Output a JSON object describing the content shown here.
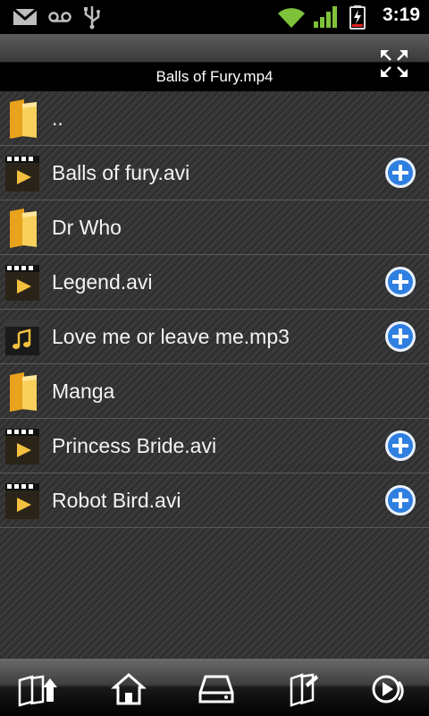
{
  "status_bar": {
    "time": "3:19",
    "icons": [
      "gmail-icon",
      "voicemail-icon",
      "usb-icon",
      "wifi-icon",
      "signal-icon",
      "battery-charging-icon"
    ]
  },
  "header": {
    "title": "Balls of Fury.mp4",
    "fullscreen_icon": "fullscreen-icon"
  },
  "files": [
    {
      "name": "..",
      "type": "folder",
      "addable": false
    },
    {
      "name": "Balls of fury.avi",
      "type": "video",
      "addable": true
    },
    {
      "name": "Dr Who",
      "type": "folder",
      "addable": false
    },
    {
      "name": "Legend.avi",
      "type": "video",
      "addable": true
    },
    {
      "name": "Love me or leave me.mp3",
      "type": "audio",
      "addable": true
    },
    {
      "name": "Manga",
      "type": "folder",
      "addable": false
    },
    {
      "name": "Princess Bride.avi",
      "type": "video",
      "addable": true
    },
    {
      "name": "Robot Bird.avi",
      "type": "video",
      "addable": true
    }
  ],
  "toolbar": {
    "items": [
      "folder-up-icon",
      "home-icon",
      "drive-icon",
      "bookmark-folder-icon",
      "playlist-icon"
    ]
  },
  "colors": {
    "accent_blue": "#2f7fe0",
    "folder_yellow": "#f3b234"
  }
}
